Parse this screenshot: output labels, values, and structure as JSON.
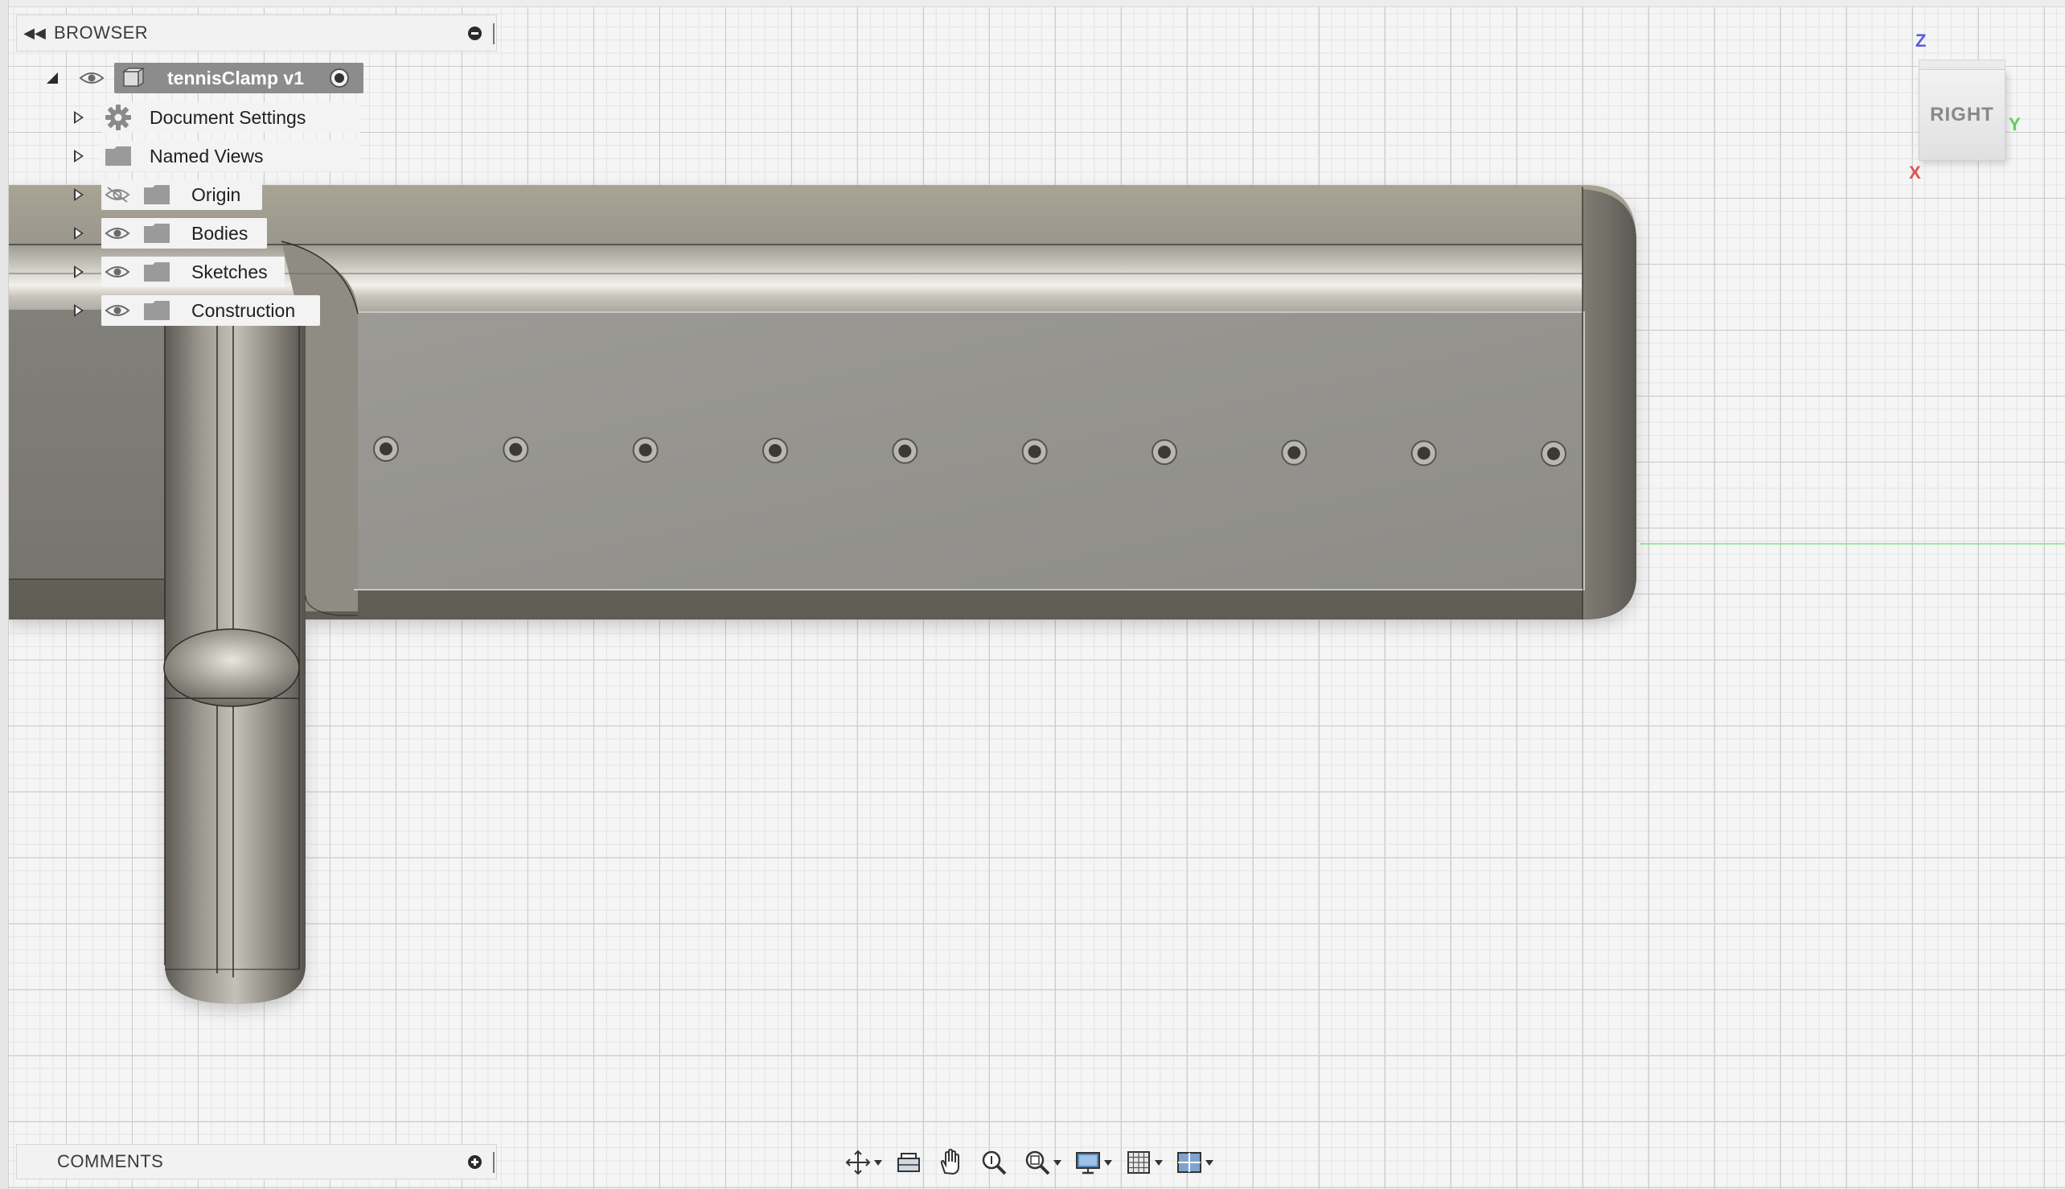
{
  "browser": {
    "title": "BROWSER",
    "root": {
      "label": "tennisClamp v1"
    },
    "items": [
      {
        "label": "Document Settings",
        "icon": "gear-icon",
        "visible": null
      },
      {
        "label": "Named Views",
        "icon": "folder-icon",
        "visible": null
      },
      {
        "label": "Origin",
        "icon": "folder-icon",
        "visible": false
      },
      {
        "label": "Bodies",
        "icon": "folder-icon",
        "visible": true
      },
      {
        "label": "Sketches",
        "icon": "folder-icon",
        "visible": true
      },
      {
        "label": "Construction",
        "icon": "folder-icon",
        "visible": true
      }
    ]
  },
  "comments": {
    "title": "COMMENTS"
  },
  "viewcube": {
    "face": "RIGHT",
    "axis_z": "Z",
    "axis_y": "Y",
    "axis_x": "X"
  },
  "model": {
    "hole_count": 10
  },
  "colors": {
    "body": "#8e8c84",
    "root_highlight": "#8c8c8c",
    "grid_major": "#c9ccce",
    "grid_minor": "#e2e4e5"
  }
}
